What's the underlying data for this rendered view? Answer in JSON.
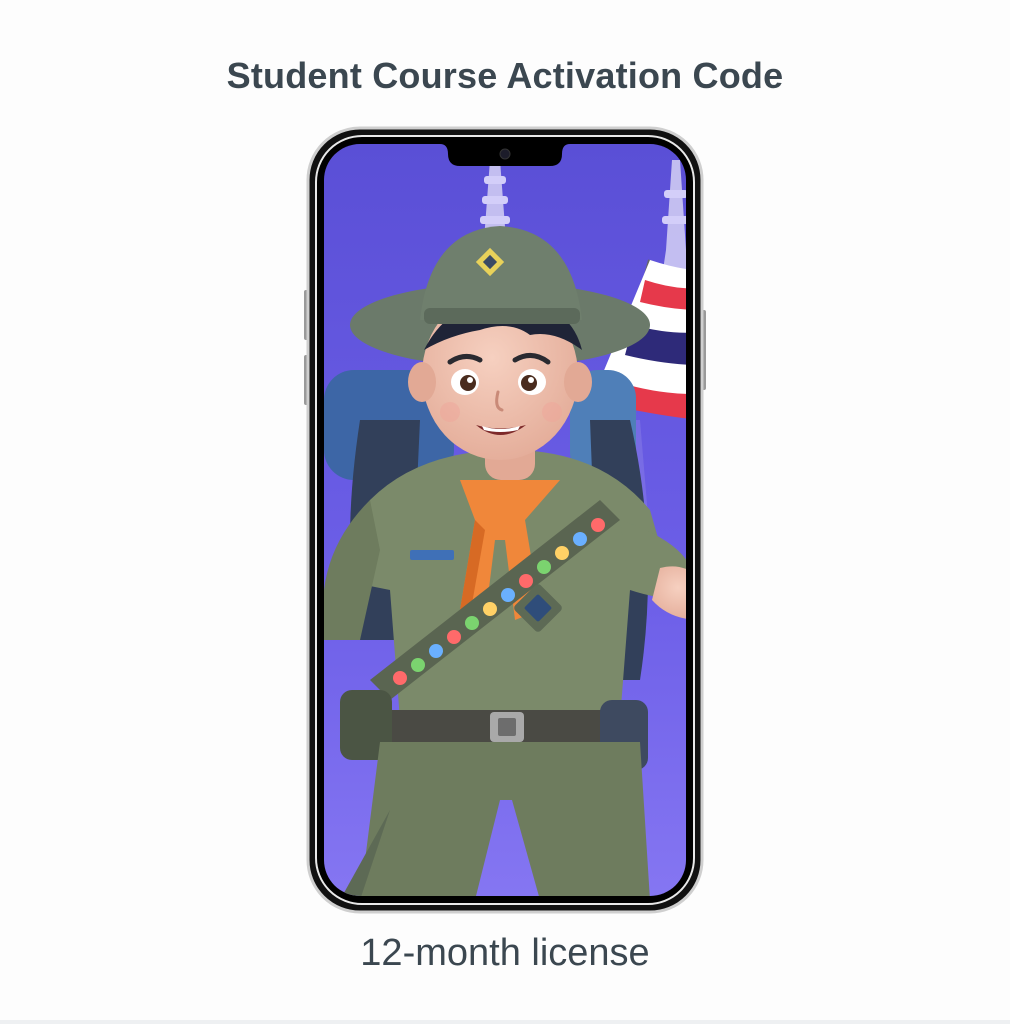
{
  "header": {
    "title": "Student Course Activation Code"
  },
  "product": {
    "caption": "12-month license",
    "illustration": "scout-character-illustration",
    "device_icon": "smartphone-icon"
  },
  "colors": {
    "title_text": "#3b4750",
    "screen_bg_top": "#5a4fd6",
    "screen_bg_bottom": "#7d6cf0",
    "phone_frame": "#111111"
  }
}
